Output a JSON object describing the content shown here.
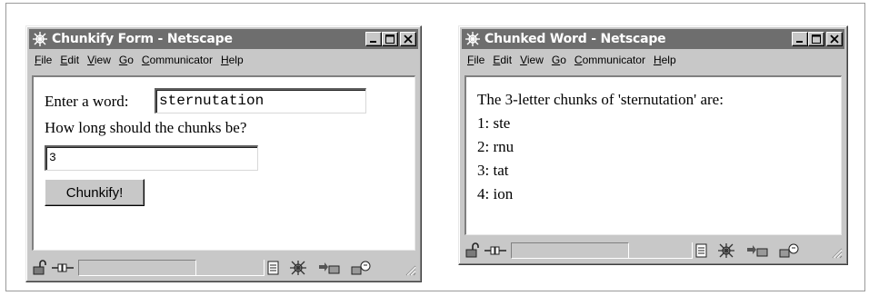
{
  "window1": {
    "title": "Chunkify Form - Netscape",
    "menu": [
      {
        "key": "F",
        "rest": "ile"
      },
      {
        "key": "E",
        "rest": "dit"
      },
      {
        "key": "V",
        "rest": "iew"
      },
      {
        "key": "G",
        "rest": "o"
      },
      {
        "key": "C",
        "rest": "ommunicator"
      },
      {
        "key": "H",
        "rest": "elp"
      }
    ],
    "form": {
      "word_label": "Enter a word:",
      "word_value": "sternutation",
      "chunk_question": "How long should the chunks be?",
      "chunk_value": "3",
      "submit_label": "Chunkify!"
    }
  },
  "window2": {
    "title": "Chunked Word - Netscape",
    "menu": [
      {
        "key": "F",
        "rest": "ile"
      },
      {
        "key": "E",
        "rest": "dit"
      },
      {
        "key": "V",
        "rest": "iew"
      },
      {
        "key": "G",
        "rest": "o"
      },
      {
        "key": "C",
        "rest": "ommunicator"
      },
      {
        "key": "H",
        "rest": "elp"
      }
    ],
    "result": {
      "heading": "The 3-letter chunks of 'sternutation' are:",
      "chunks": [
        "1: ste",
        "2: rnu",
        "3: tat",
        "4: ion"
      ]
    }
  },
  "icons": {
    "title_logo": "netscape-logo-icon",
    "minimize": "minimize-icon",
    "maximize": "maximize-icon",
    "close": "close-icon",
    "lock": "security-lock-icon",
    "connection": "connection-plug-icon",
    "page_info": "page-info-icon",
    "navigator": "navigator-icon",
    "mail": "mail-icon",
    "composer": "composer-icon",
    "grip": "resize-grip-icon"
  }
}
